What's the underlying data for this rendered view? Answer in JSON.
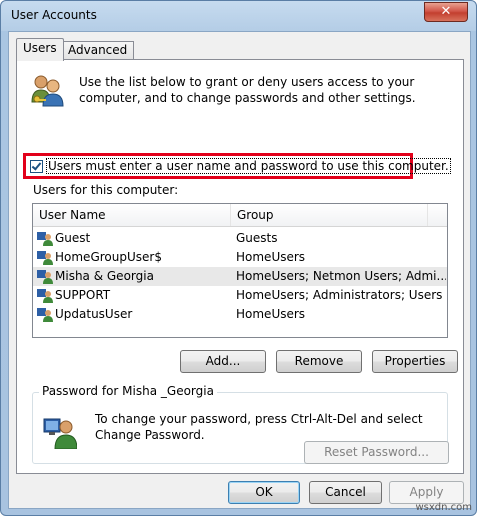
{
  "window": {
    "title": "User Accounts",
    "close_glyph": "✕"
  },
  "tabs": [
    {
      "label": "Users",
      "active": true
    },
    {
      "label": "Advanced",
      "active": false
    }
  ],
  "intro_text": "Use the list below to grant or deny users access to your computer, and to change passwords and other settings.",
  "require_password": {
    "checked": true,
    "label": "Users must enter a user name and password to use this computer."
  },
  "users_caption": "Users for this computer:",
  "users_table": {
    "columns": [
      "User Name",
      "Group"
    ],
    "rows": [
      {
        "name": "Guest",
        "group": "Guests",
        "selected": false
      },
      {
        "name": "HomeGroupUser$",
        "group": "HomeUsers",
        "selected": false
      },
      {
        "name": "Misha & Georgia",
        "group": "HomeUsers; Netmon Users; Admi...",
        "selected": true
      },
      {
        "name": "SUPPORT",
        "group": "HomeUsers; Administrators; Users",
        "selected": false
      },
      {
        "name": "UpdatusUser",
        "group": "HomeUsers",
        "selected": false
      }
    ]
  },
  "list_buttons": {
    "add": "Add...",
    "remove": "Remove",
    "properties": "Properties"
  },
  "password_group": {
    "legend": "Password for Misha _Georgia",
    "text": "To change your password, press Ctrl-Alt-Del and select Change Password.",
    "reset_button": "Reset Password..."
  },
  "footer_buttons": {
    "ok": "OK",
    "cancel": "Cancel",
    "apply": "Apply"
  },
  "watermark": "wsxdn.com",
  "colors": {
    "highlight_border": "#e2001a",
    "selected_row": "#e8e8e8",
    "titlebar": "#b4cde6"
  }
}
